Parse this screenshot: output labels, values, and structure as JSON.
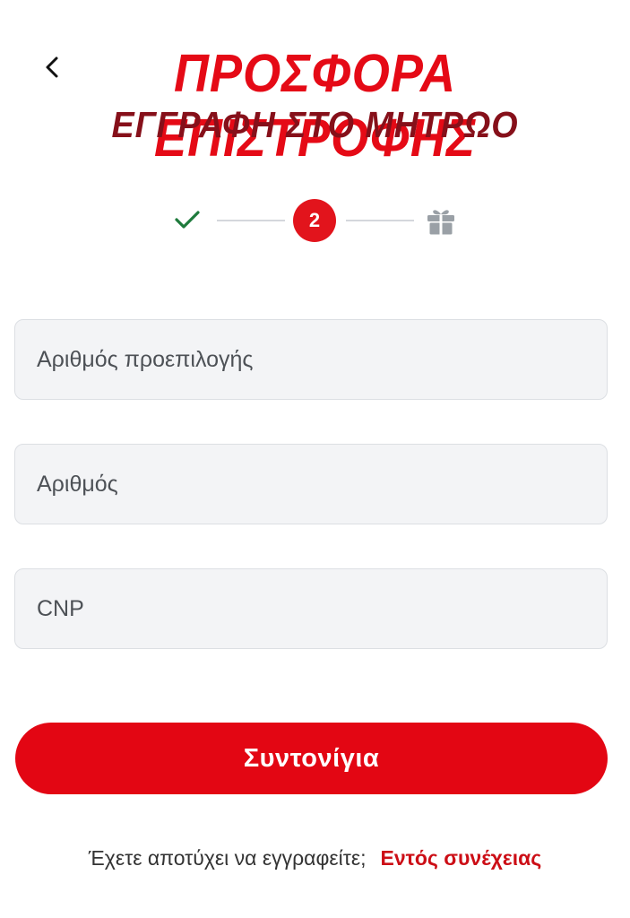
{
  "header": {
    "title_main": "ΠΡΟΣΦΟΡΑ ΕΠΙΣΤΡΟΦΗΣ",
    "title_sub": "ΕΓΓΡΑΦΗ ΣΤΟ ΜΗΤΡΩΟ",
    "back_icon": "chevron-left-icon"
  },
  "stepper": {
    "current_step": "2",
    "completed_icon": "checkmark-icon",
    "final_icon": "gift-icon"
  },
  "form": {
    "fields": [
      {
        "placeholder": "Αριθμός προεπιλογής",
        "value": ""
      },
      {
        "placeholder": "Αριθμός",
        "value": ""
      },
      {
        "placeholder": "CNP",
        "value": ""
      }
    ],
    "submit_label": "Συντονίγια"
  },
  "footer": {
    "question": "Έχετε αποτύχει να εγγραφείτε;",
    "link_label": "Εντός συνέχειας"
  },
  "colors": {
    "brand_red": "#e30613",
    "title_dark_red": "#86101a",
    "check_green": "#1e7a3c",
    "field_bg": "#f3f4f6",
    "inactive_gray": "#9aa0a6"
  }
}
